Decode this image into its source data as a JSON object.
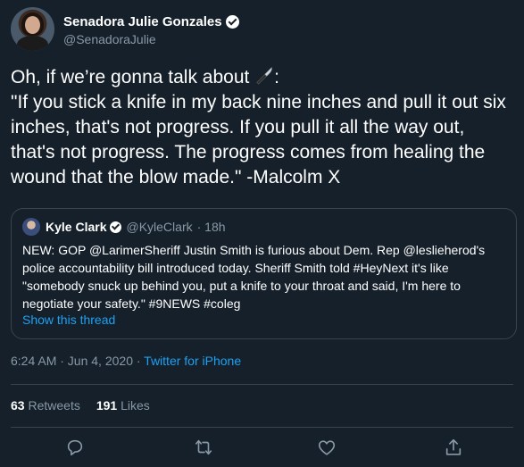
{
  "author": {
    "display_name": "Senadora Julie Gonzales",
    "handle": "@SenadoraJulie"
  },
  "tweet_text": "Oh, if we’re gonna talk about ",
  "tweet_text_after_icon": ":\n\"If you stick a knife in my back nine inches and pull it out six inches, that's not progress. If you pull it all the way out, that's not progress. The progress comes from healing the wound that the blow made.\" -Malcolm X",
  "quoted_tweet": {
    "display_name": "Kyle Clark",
    "handle": "@KyleClark",
    "time": "· 18h",
    "text": "NEW: GOP @LarimerSheriff Justin Smith is furious about Dem. Rep @leslieherod's police accountability bill introduced today. Sheriff Smith told #HeyNext it's like \"somebody snuck up behind you, put a knife to your throat and said, I'm here to negotiate your safety.\" #9NEWS #coleg",
    "show_thread": "Show this thread"
  },
  "meta": {
    "timestamp": "6:24 AM · Jun 4, 2020 · ",
    "source": "Twitter for iPhone"
  },
  "stats": {
    "retweets_count": "63",
    "retweets_label": "Retweets",
    "likes_count": "191",
    "likes_label": "Likes"
  },
  "icons": {
    "knife": "kitchen-knife-emoji",
    "reply": "reply-icon",
    "retweet": "retweet-icon",
    "like": "like-icon",
    "share": "share-icon"
  },
  "colors": {
    "background": "#15202b",
    "text": "#ffffff",
    "secondary": "#8899a6",
    "link": "#1da1f2",
    "border": "#38444d"
  }
}
